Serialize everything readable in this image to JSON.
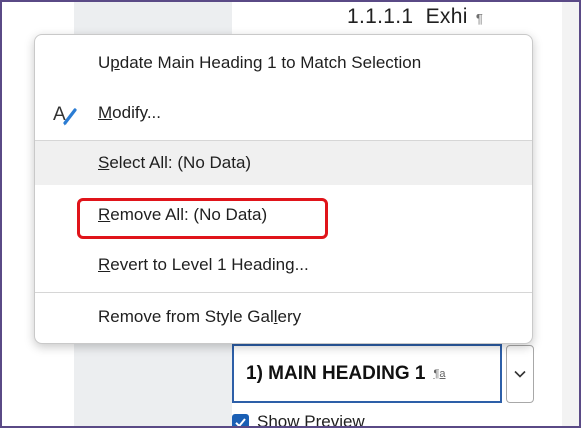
{
  "document": {
    "heading_number": "1.1.1.1",
    "heading_text": "Exhi",
    "pilcrow": "¶"
  },
  "context_menu": {
    "items": [
      {
        "label": "Update Main Heading 1 to Match Selection",
        "mnemonic_index": 1
      },
      {
        "label": "Modify...",
        "mnemonic_index": 0,
        "icon": "modify-style-icon"
      },
      {
        "label": "Select All: (No Data)",
        "mnemonic_index": 0
      },
      {
        "label": "Remove All: (No Data)",
        "mnemonic_index": 0
      },
      {
        "label": "Revert to Level 1 Heading...",
        "mnemonic_index": 0
      },
      {
        "label": "Remove from Style Gallery",
        "mnemonic_index": 21
      }
    ],
    "highlighted_item": "Remove All: (No Data)",
    "highlight_color": "#e0141a"
  },
  "style_selector": {
    "value": "1)  MAIN HEADING 1",
    "mark": "¶a",
    "dropdown_icon": "chevron-down-icon"
  },
  "show_preview": {
    "label": "Show Preview",
    "checked": true
  },
  "colors": {
    "accent": "#1a5fb4",
    "frame_border": "#5a4a86"
  }
}
